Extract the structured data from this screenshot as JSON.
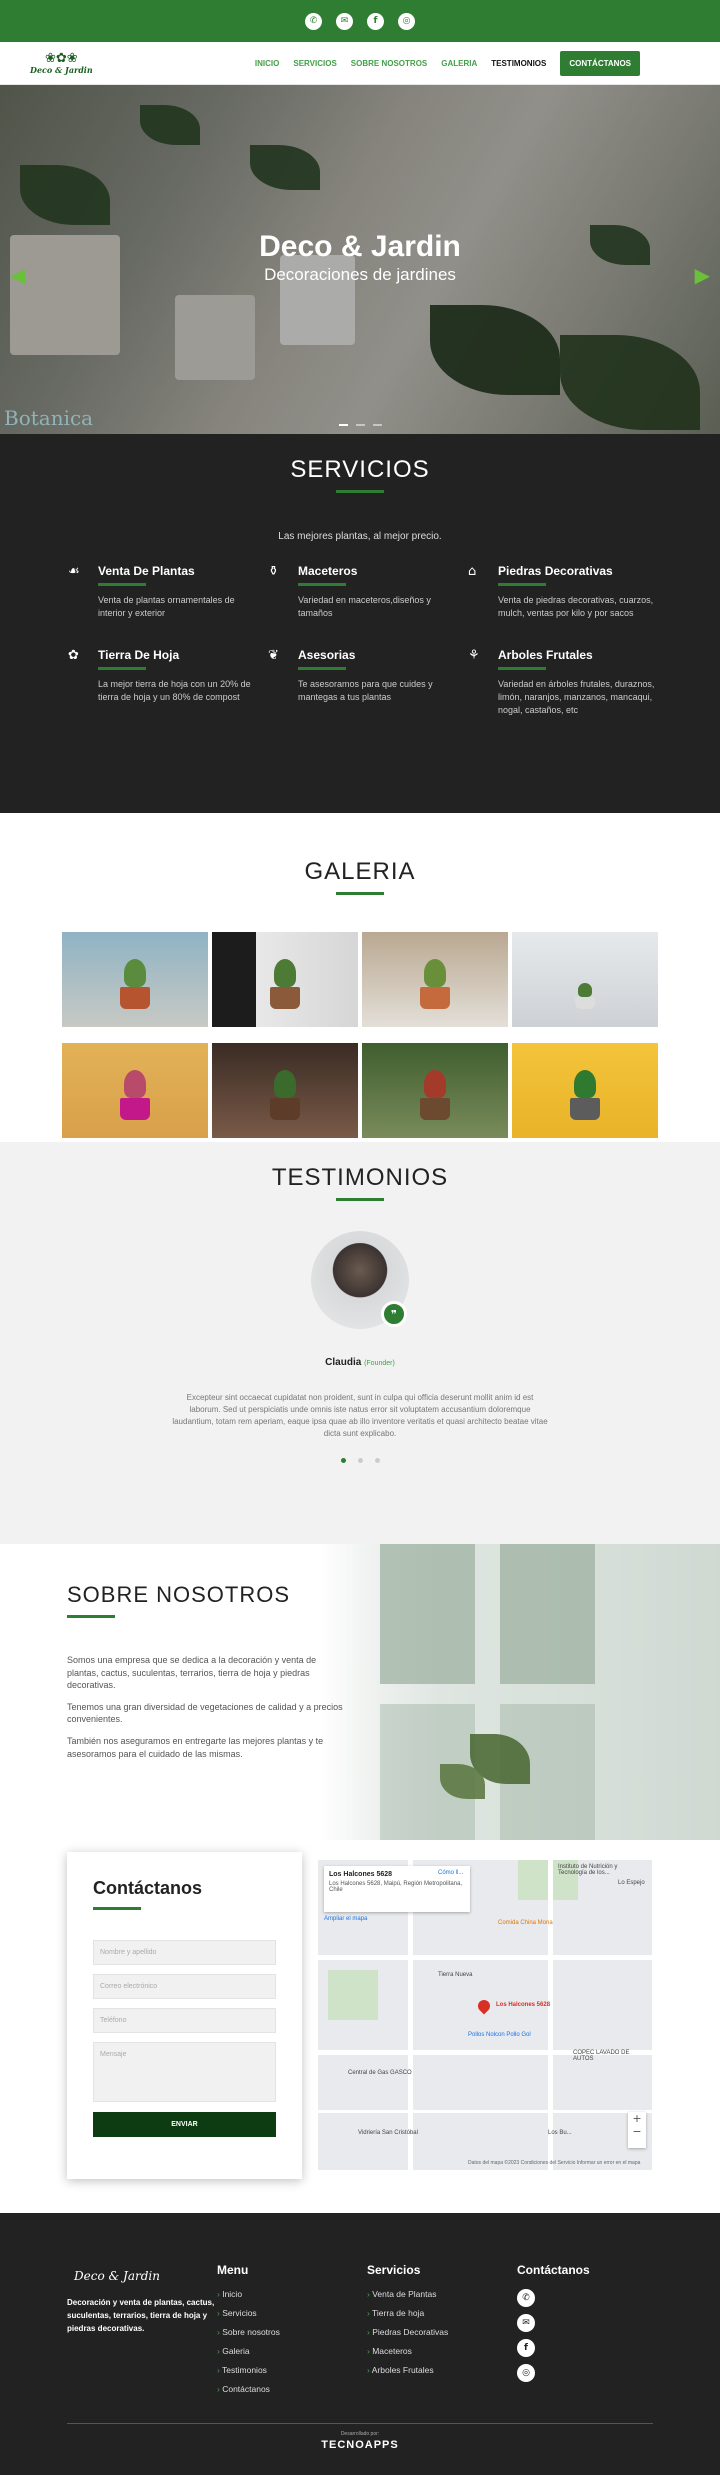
{
  "topbar": {
    "icons": [
      "whatsapp-icon",
      "email-icon",
      "facebook-icon",
      "instagram-icon"
    ]
  },
  "brand": {
    "mark": "❀✿❀",
    "name": "Deco & Jardin"
  },
  "nav": {
    "items": [
      "INICIO",
      "SERVICIOS",
      "SOBRE NOSOTROS",
      "GALERIA",
      "TESTIMONIOS"
    ],
    "cta": "CONTÁCTANOS"
  },
  "hero": {
    "title": "Deco & Jardin",
    "subtitle": "Decoraciones de jardines",
    "watermark": "Botanica"
  },
  "services": {
    "title": "SERVICIOS",
    "subtitle": "Las mejores plantas, al mejor precio.",
    "items": [
      {
        "title": "Venta De Plantas",
        "text": "Venta de plantas ornamentales de interior y exterior"
      },
      {
        "title": "Maceteros",
        "text": "Variedad en maceteros,diseños y tamaños"
      },
      {
        "title": "Piedras Decorativas",
        "text": "Venta de piedras decorativas, cuarzos, mulch, ventas por kilo y por sacos"
      },
      {
        "title": "Tierra De Hoja",
        "text": "La mejor tierra de hoja con un 20% de tierra de hoja y un 80% de compost"
      },
      {
        "title": "Asesorias",
        "text": "Te asesoramos para que cuides y mantegas a tus plantas"
      },
      {
        "title": "Arboles Frutales",
        "text": "Variedad en árboles frutales, duraznos, limón, naranjos, manzanos, mancaqui, nogal, castaños, etc"
      }
    ]
  },
  "gallery": {
    "title": "GALERIA"
  },
  "testimonials": {
    "title": "TESTIMONIOS",
    "name": "Claudia",
    "role": "(Founder)",
    "quote": "Excepteur sint occaecat cupidatat non proident, sunt in culpa qui officia deserunt mollit anim id est laborum. Sed ut perspiciatis unde omnis iste natus error sit voluptatem accusantium doloremque laudantium, totam rem aperiam, eaque ipsa quae ab illo inventore veritatis et quasi architecto beatae vitae dicta sunt explicabo."
  },
  "about": {
    "title": "SOBRE NOSOTROS",
    "paragraphs": [
      "Somos una empresa que se dedica a la decoración y venta de plantas, cactus, suculentas, terrarios, tierra de hoja y piedras decorativas.",
      "Tenemos una gran diversidad de vegetaciones de calidad y a precios convenientes.",
      "También nos aseguramos en entregarte las mejores plantas y te asesoramos para el cuidado de las mismas."
    ]
  },
  "contact": {
    "title": "Contáctanos",
    "name_placeholder": "Nombre y apellido",
    "email_placeholder": "Correo electrónico",
    "phone_placeholder": "Teléfono",
    "message_placeholder": "Mensaje",
    "send": "ENVIAR"
  },
  "map": {
    "place": "Los Halcones 5628",
    "address": "Los Halcones 5628, Maipú, Región Metropolitana, Chile",
    "directions": "Cómo ll...",
    "enlarge": "Ampliar el mapa",
    "pin_label": "Los Halcones 5628",
    "labels": [
      "Instituto de Nutrición y Tecnología de los...",
      "Comida China Mona",
      "Lo Espejo",
      "Tierra Nueva",
      "Pollos Nolcon Pollo Gol",
      "Central de Gas GASCO",
      "COPEC LAVADO DE AUTOS",
      "Vidriería San Cristóbal",
      "Los Bu..."
    ],
    "footer": "Datos del mapa ©2023   Condiciones del Servicio   Informar un error en el mapa"
  },
  "footer": {
    "about": "Decoración y venta de plantas, cactus, suculentas, terrarios, tierra de hoja y piedras decorativas.",
    "menu_title": "Menu",
    "menu": [
      "Inicio",
      "Servicios",
      "Sobre nosotros",
      "Galeria",
      "Testimonios",
      "Contáctanos"
    ],
    "services_title": "Servicios",
    "services": [
      "Venta de Plantas",
      "Tierra de hoja",
      "Piedras Decorativas",
      "Maceteros",
      "Arboles Frutales"
    ],
    "contact_title": "Contáctanos",
    "contact_icons": [
      "whatsapp-icon",
      "email-icon",
      "facebook-icon",
      "instagram-icon"
    ],
    "credit": "Desarrollado por:",
    "credit_brand": "TECNOAPPS"
  },
  "colors": {
    "brand": "#2e7d32",
    "dark": "#222222",
    "cta_dark": "#0d3b12"
  }
}
